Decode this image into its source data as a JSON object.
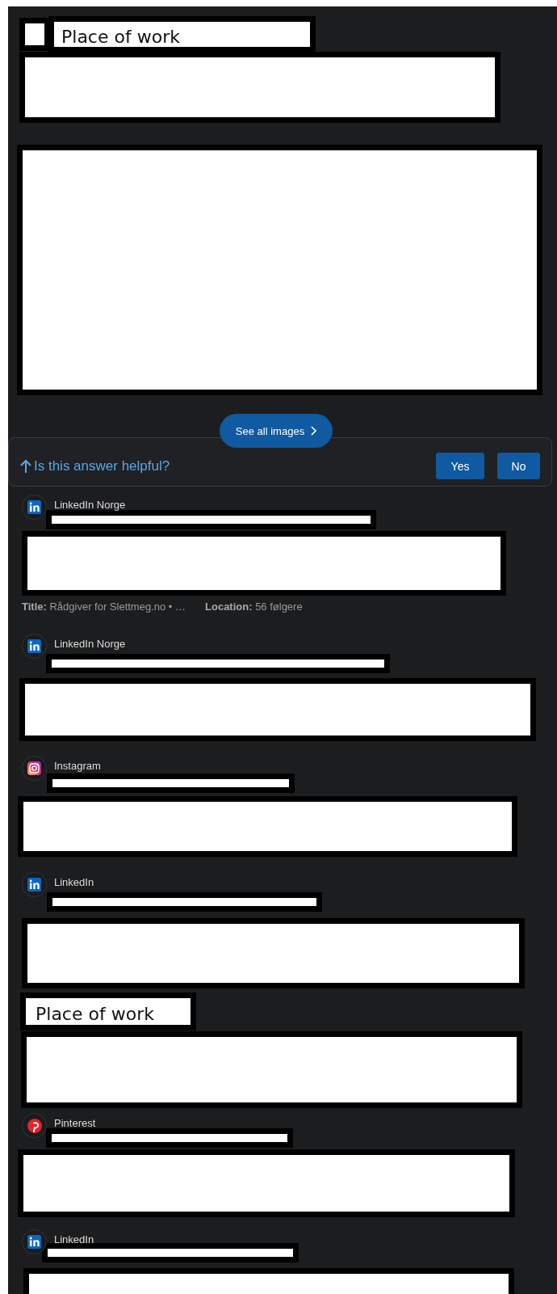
{
  "top_section": {
    "heading": "Place of work"
  },
  "images": {
    "see_all": "See all images"
  },
  "feedback": {
    "question": "Is this answer helpful?",
    "buttons": [
      "Yes",
      "No"
    ]
  },
  "results": [
    {
      "kind": "linkedin",
      "source": "LinkedIn Norge",
      "meta": [
        "**Title:** Rådgiver for Slettmeg.no • …",
        "**Location:** 56 følgere"
      ]
    },
    {
      "kind": "linkedin",
      "source": "LinkedIn Norge"
    },
    {
      "kind": "instagram",
      "source": "Instagram"
    },
    {
      "kind": "linkedin",
      "source": "LinkedIn"
    },
    {
      "kind": "heading",
      "text": "Place of work"
    },
    {
      "kind": "pinterest",
      "source": "Pinterest"
    },
    {
      "kind": "linkedin",
      "source": "LinkedIn"
    }
  ]
}
